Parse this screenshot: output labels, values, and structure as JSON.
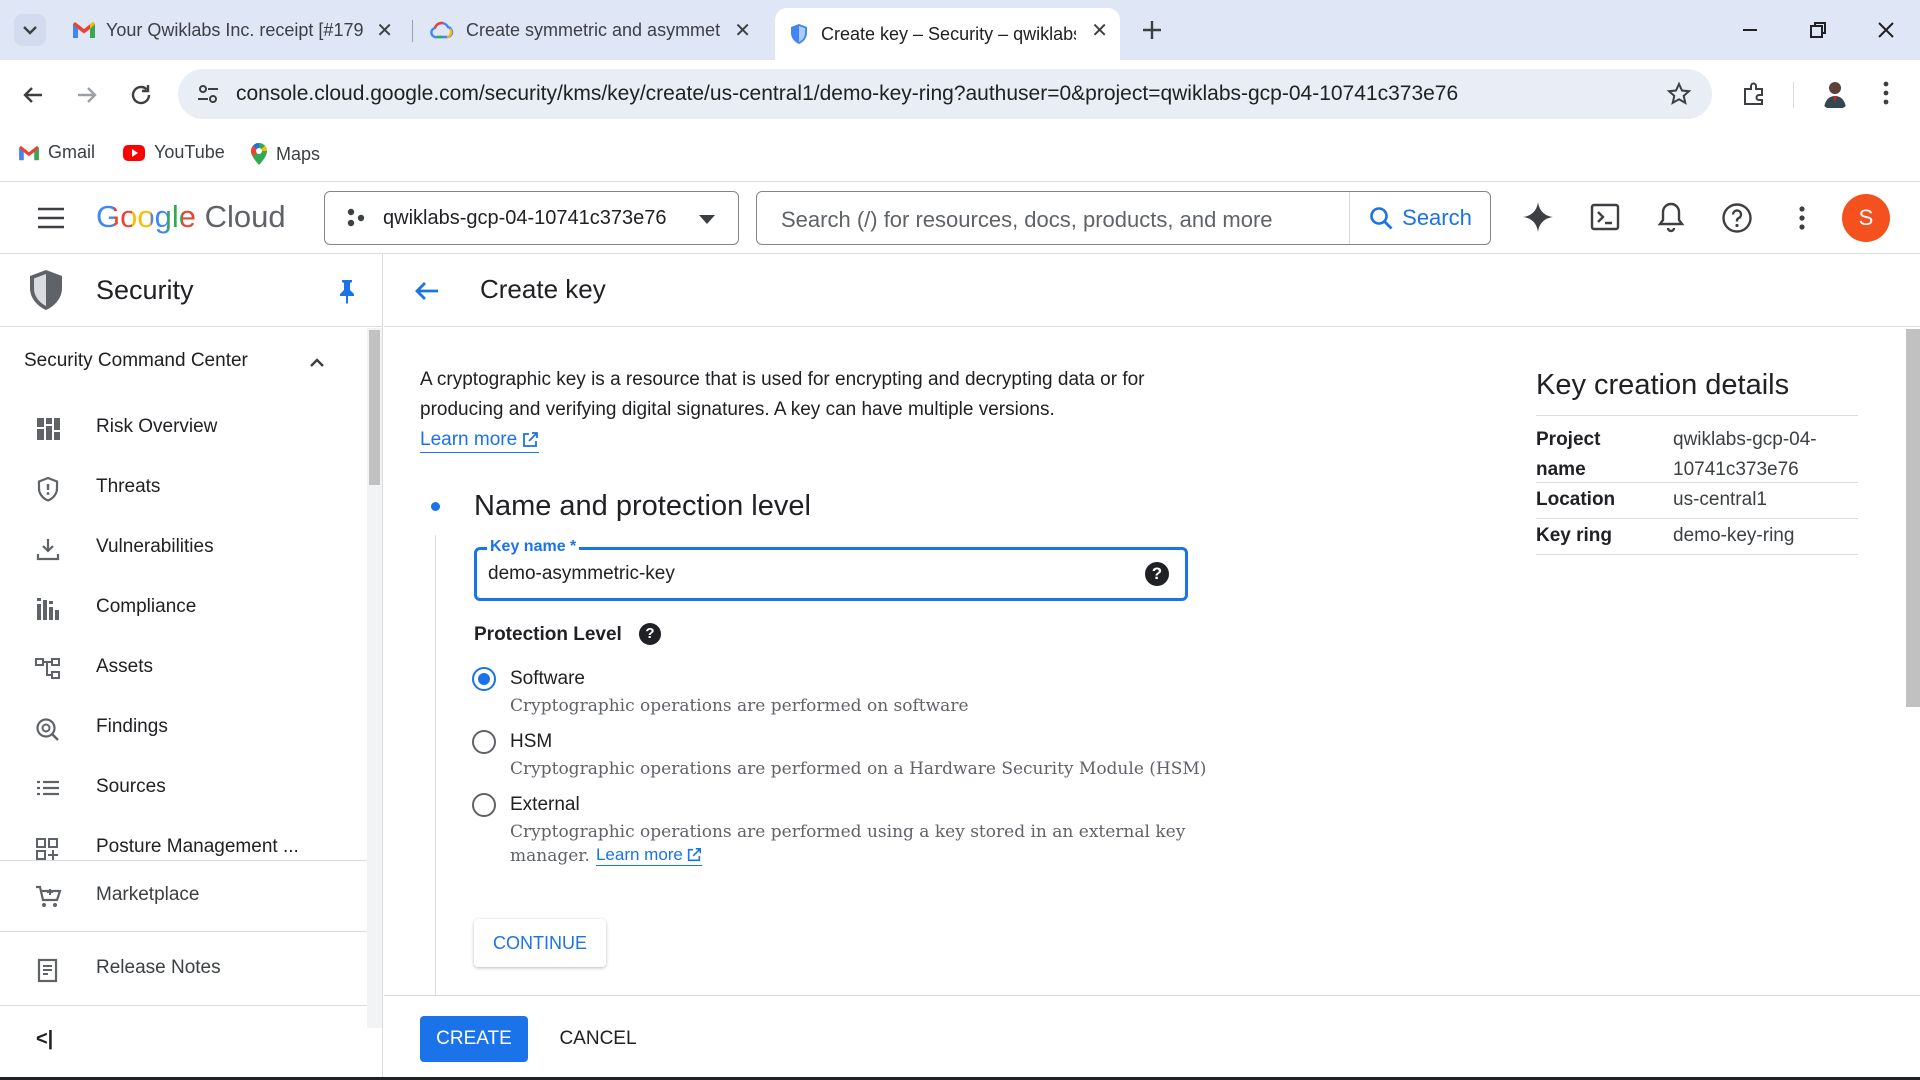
{
  "browser": {
    "tabs": [
      {
        "title": "Your Qwiklabs Inc. receipt [#179",
        "icon": "gmail-icon"
      },
      {
        "title": "Create symmetric and asymmet",
        "icon": "google-cloud-icon"
      },
      {
        "title": "Create key – Security – qwiklabs",
        "icon": "shield-icon"
      }
    ],
    "url": "console.cloud.google.com/security/kms/key/create/us-central1/demo-key-ring?authuser=0&project=qwiklabs-gcp-04-10741c373e76",
    "bookmarks": [
      "Gmail",
      "YouTube",
      "Maps"
    ]
  },
  "header": {
    "brand_google": "Google",
    "brand_cloud": "Cloud",
    "project": "qwiklabs-gcp-04-10741c373e76",
    "search_placeholder": "Search (/) for resources, docs, products, and more",
    "search_button": "Search",
    "avatar_letter": "S",
    "avatar_color": "#f4511e"
  },
  "sidebar": {
    "product": "Security",
    "section": "Security Command Center",
    "items": [
      {
        "label": "Risk Overview",
        "icon": "dashboard-icon"
      },
      {
        "label": "Threats",
        "icon": "shield-alert-icon"
      },
      {
        "label": "Vulnerabilities",
        "icon": "download-bug-icon"
      },
      {
        "label": "Compliance",
        "icon": "bar-chart-icon"
      },
      {
        "label": "Assets",
        "icon": "hierarchy-icon"
      },
      {
        "label": "Findings",
        "icon": "search-findings-icon"
      },
      {
        "label": "Sources",
        "icon": "list-icon"
      },
      {
        "label": "Posture Management ...",
        "icon": "grid-plus-icon"
      }
    ],
    "marketplace": "Marketplace",
    "release_notes": "Release Notes",
    "collapse_label": "<|"
  },
  "main": {
    "title": "Create key",
    "intro_line1": "A cryptographic key is a resource that is used for encrypting and decrypting data or for",
    "intro_line2": "producing and verifying digital signatures. A key can have multiple versions.",
    "learn_more": "Learn more",
    "step_title": "Name and protection level",
    "key_name_label": "Key name *",
    "key_name_value": "demo-asymmetric-key",
    "protection_level_label": "Protection Level",
    "options": [
      {
        "label": "Software",
        "desc": "Cryptographic operations are performed on software",
        "selected": true
      },
      {
        "label": "HSM",
        "desc": "Cryptographic operations are performed on a Hardware Security Module (HSM)",
        "selected": false
      },
      {
        "label": "External",
        "desc_line1": "Cryptographic operations are performed using a key stored in an external key",
        "desc_line2": "manager.",
        "learn_more": "Learn more",
        "selected": false
      }
    ],
    "continue_button": "CONTINUE",
    "create_button": "CREATE",
    "cancel_button": "CANCEL"
  },
  "details": {
    "title": "Key creation details",
    "rows": [
      {
        "key_line1": "Project",
        "key_line2": "name",
        "value_line1": "qwiklabs-gcp-04-",
        "value_line2": "10741c373e76"
      },
      {
        "key": "Location",
        "value": "us-central1"
      },
      {
        "key": "Key ring",
        "value": "demo-key-ring"
      }
    ]
  },
  "colors": {
    "accent": "#1a73e8",
    "tabbar": "#dfe7f6"
  }
}
